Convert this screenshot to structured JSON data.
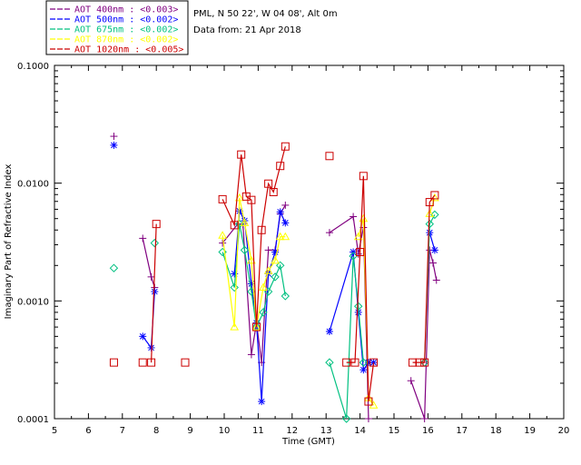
{
  "info": {
    "station": "PML, N 50 22', W 04 08', Alt 0m",
    "date": "Data from: 21 Apr 2018"
  },
  "chart_data": {
    "type": "scatter",
    "title": "",
    "xlabel": "Time (GMT)",
    "ylabel": "Imaginary Part of Refractive Index",
    "xlim": [
      5,
      20
    ],
    "ylim": [
      0.0001,
      0.1
    ],
    "yscale": "log",
    "x_ticks": [
      "5",
      "6",
      "7",
      "8",
      "9",
      "10",
      "11",
      "12",
      "13",
      "14",
      "15",
      "16",
      "17",
      "18",
      "19",
      "20"
    ],
    "y_ticks": [
      "0.0001",
      "0.0010",
      "0.0100",
      "0.1000"
    ],
    "legend_position": "top-left",
    "grid": false,
    "series": [
      {
        "name": "AOT  400nm : <0.003>",
        "color": "#800080",
        "marker": "plus",
        "points": [
          [
            6.75,
            0.025
          ],
          [
            7.6,
            0.0034
          ],
          [
            7.85,
            0.0016
          ],
          [
            7.95,
            0.0013
          ],
          [
            9.95,
            0.0031
          ],
          [
            10.4,
            0.0045
          ],
          [
            10.55,
            0.0045
          ],
          [
            10.8,
            0.00035
          ],
          [
            10.95,
            0.00065
          ],
          [
            11.1,
            0.0003
          ],
          [
            11.3,
            0.0027
          ],
          [
            11.5,
            0.0027
          ],
          [
            11.65,
            0.0055
          ],
          [
            11.8,
            0.0065
          ],
          [
            13.1,
            0.0038
          ],
          [
            13.8,
            0.0052
          ],
          [
            13.95,
            0.0025
          ],
          [
            14.1,
            0.0042
          ],
          [
            14.25,
            0.0001
          ],
          [
            15.5,
            0.00021
          ],
          [
            15.9,
            0.0001
          ],
          [
            16.05,
            0.0027
          ],
          [
            16.15,
            0.0021
          ],
          [
            16.25,
            0.0015
          ]
        ],
        "breaks_after": [
          0,
          3,
          13,
          18
        ]
      },
      {
        "name": "AOT  500nm : <0.002>",
        "color": "#0000ff",
        "marker": "star",
        "points": [
          [
            6.75,
            0.021
          ],
          [
            7.6,
            0.0005
          ],
          [
            7.85,
            0.0004
          ],
          [
            7.95,
            0.0012
          ],
          [
            10.3,
            0.0017
          ],
          [
            10.45,
            0.0058
          ],
          [
            10.6,
            0.0048
          ],
          [
            10.8,
            0.0014
          ],
          [
            10.95,
            0.00065
          ],
          [
            11.1,
            0.00014
          ],
          [
            11.3,
            0.0017
          ],
          [
            11.5,
            0.0026
          ],
          [
            11.65,
            0.0057
          ],
          [
            11.8,
            0.0046
          ],
          [
            13.1,
            0.00055
          ],
          [
            13.8,
            0.0026
          ],
          [
            13.95,
            0.0008
          ],
          [
            14.1,
            0.00026
          ],
          [
            14.25,
            0.0003
          ],
          [
            14.4,
            0.0003
          ],
          [
            16.05,
            0.0038
          ],
          [
            16.2,
            0.0027
          ]
        ],
        "breaks_after": [
          0,
          3,
          13,
          19
        ]
      },
      {
        "name": "AOT  675nm : <0.002>",
        "color": "#00c080",
        "marker": "diamond",
        "points": [
          [
            6.75,
            0.0019
          ],
          [
            7.95,
            0.0031
          ],
          [
            9.95,
            0.0026
          ],
          [
            10.3,
            0.0013
          ],
          [
            10.45,
            0.0045
          ],
          [
            10.6,
            0.0027
          ],
          [
            10.8,
            0.0012
          ],
          [
            10.95,
            0.0006
          ],
          [
            11.15,
            0.0008
          ],
          [
            11.3,
            0.0012
          ],
          [
            11.5,
            0.0016
          ],
          [
            11.65,
            0.002
          ],
          [
            11.8,
            0.0011
          ],
          [
            13.1,
            0.0003
          ],
          [
            13.6,
            0.0001
          ],
          [
            13.8,
            0.0024
          ],
          [
            13.95,
            0.0009
          ],
          [
            14.1,
            0.0003
          ],
          [
            15.9,
            0.0003
          ],
          [
            16.05,
            0.0045
          ],
          [
            16.2,
            0.0054
          ]
        ],
        "breaks_after": [
          0,
          1,
          12,
          17
        ]
      },
      {
        "name": "AOT  870nm : <0.002>",
        "color": "#ffff00",
        "marker": "triangle",
        "points": [
          [
            9.95,
            0.0036
          ],
          [
            10.3,
            0.0006
          ],
          [
            10.45,
            0.0075
          ],
          [
            10.6,
            0.0046
          ],
          [
            10.8,
            0.0022
          ],
          [
            10.95,
            0.0006
          ],
          [
            11.15,
            0.0013
          ],
          [
            11.3,
            0.0018
          ],
          [
            11.5,
            0.0022
          ],
          [
            11.65,
            0.0035
          ],
          [
            11.8,
            0.0035
          ],
          [
            13.95,
            0.0035
          ],
          [
            14.1,
            0.005
          ],
          [
            14.25,
            0.00015
          ],
          [
            14.4,
            0.00013
          ],
          [
            16.05,
            0.0055
          ],
          [
            16.2,
            0.0075
          ]
        ],
        "breaks_after": [
          10,
          14
        ]
      },
      {
        "name": "AOT 1020nm : <0.005>",
        "color": "#cc0000",
        "marker": "square",
        "points": [
          [
            6.75,
            0.0003
          ],
          [
            7.6,
            0.0003
          ],
          [
            7.85,
            0.0003
          ],
          [
            8.0,
            0.0045
          ],
          [
            8.85,
            0.0003
          ],
          [
            9.95,
            0.0073
          ],
          [
            10.3,
            0.0044
          ],
          [
            10.5,
            0.0175
          ],
          [
            10.65,
            0.0077
          ],
          [
            10.8,
            0.0072
          ],
          [
            10.95,
            0.0006
          ],
          [
            11.1,
            0.004
          ],
          [
            11.3,
            0.0099
          ],
          [
            11.45,
            0.0084
          ],
          [
            11.65,
            0.014
          ],
          [
            11.8,
            0.0205
          ],
          [
            13.1,
            0.017
          ],
          [
            13.6,
            0.0003
          ],
          [
            13.85,
            0.0003
          ],
          [
            14.0,
            0.0026
          ],
          [
            14.1,
            0.0115
          ],
          [
            14.25,
            0.00014
          ],
          [
            14.4,
            0.0003
          ],
          [
            15.55,
            0.0003
          ],
          [
            15.75,
            0.0003
          ],
          [
            15.9,
            0.0003
          ],
          [
            16.05,
            0.0069
          ],
          [
            16.2,
            0.0079
          ]
        ],
        "breaks_after": [
          0,
          1,
          3,
          4,
          15,
          16,
          22
        ]
      }
    ]
  }
}
